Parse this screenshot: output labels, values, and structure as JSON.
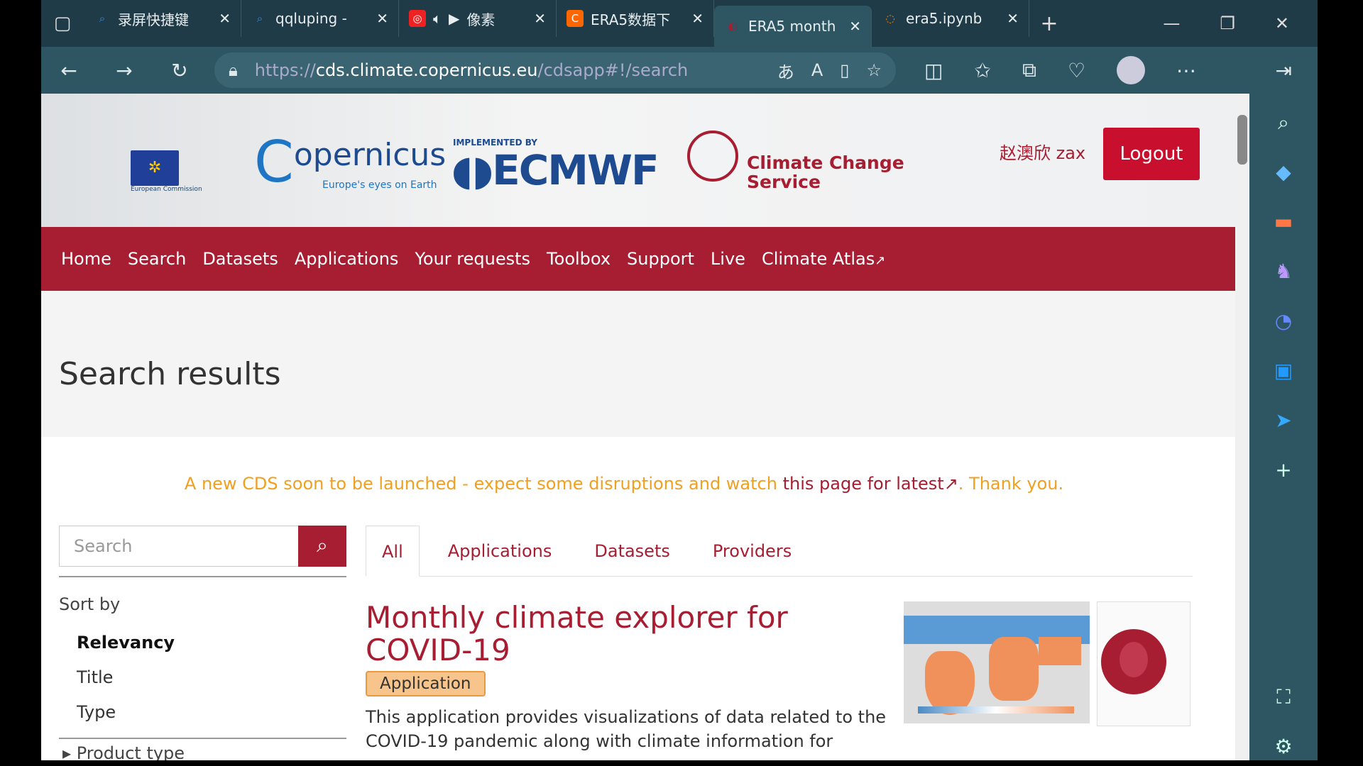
{
  "browser": {
    "tabs": [
      {
        "title": "录屏快捷键",
        "icon": "search-icon"
      },
      {
        "title": "qqluping - ",
        "icon": "search-icon"
      },
      {
        "title": "像素",
        "icon": "netease-music-icon"
      },
      {
        "title": "ERA5数据下",
        "icon": "csdn-icon"
      },
      {
        "title": "ERA5 month",
        "icon": "copernicus-icon",
        "active": true
      },
      {
        "title": "era5.ipynb",
        "icon": "jupyter-icon"
      }
    ],
    "url_prefix": "https://",
    "url_host": "cds.climate.copernicus.eu",
    "url_path": "/cdsapp#!/search"
  },
  "header": {
    "user": "赵澳欣 zax",
    "logout": "Logout",
    "eu_label": "European Commission",
    "copernicus": "opernicus",
    "copernicus_tagline": "Europe's eyes on Earth",
    "implemented_by": "IMPLEMENTED BY",
    "ecmwf": "ECMWF",
    "ccs_line1": "Climate Change",
    "ccs_line2": "Service"
  },
  "nav": [
    "Home",
    "Search",
    "Datasets",
    "Applications",
    "Your requests",
    "Toolbox",
    "Support",
    "Live",
    "Climate Atlas"
  ],
  "page": {
    "title": "Search results",
    "notice_a": "A new CDS soon to be launched - expect some disruptions and watch ",
    "notice_link": "this page for latest",
    "notice_b": ". Thank you.",
    "search_placeholder": "Search",
    "tabs": [
      "All",
      "Applications",
      "Datasets",
      "Providers"
    ],
    "sort_by": "Sort by",
    "sort_options": [
      "Relevancy",
      "Title",
      "Type"
    ],
    "product_type": "Product type",
    "result": {
      "title": "Monthly climate explorer for COVID-19",
      "badge": "Application",
      "desc": "This application provides visualizations of data related to the",
      "desc2": "COVID-19 pandemic along with climate information for"
    }
  },
  "colors": {
    "brand": "#a71d31",
    "notice": "#f0a020",
    "badge": "#f7c58c"
  }
}
